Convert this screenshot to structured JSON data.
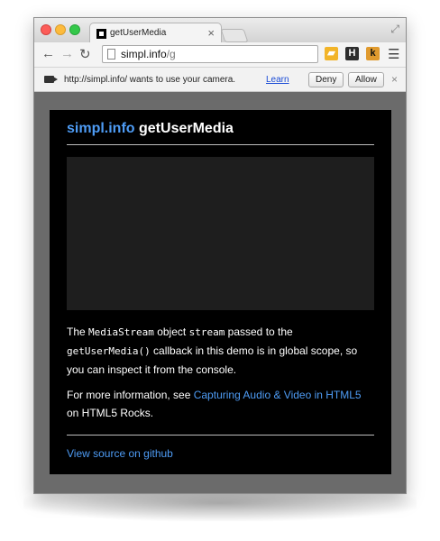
{
  "browser": {
    "tab": {
      "title": "getUserMedia"
    },
    "address": {
      "host": "simpl.info",
      "path": "/g"
    },
    "toolbar": {
      "back_icon": "arrow-left-icon",
      "forward_icon": "arrow-right-icon",
      "reload_icon": "reload-icon",
      "extensions": [
        {
          "name": "folder-extension-icon",
          "glyph": ""
        },
        {
          "name": "h-extension-icon",
          "glyph": "H"
        },
        {
          "name": "k-extension-icon",
          "glyph": "k"
        }
      ]
    },
    "infobar": {
      "message": "http://simpl.info/ wants to use your camera.",
      "learn_link": "Learn",
      "deny_label": "Deny",
      "allow_label": "Allow"
    }
  },
  "page": {
    "title_brand": "simpl.info",
    "title_rest": " getUserMedia",
    "para1": {
      "text1": "The ",
      "code1": "MediaStream",
      "text2": " object ",
      "code2": "stream",
      "text3": " passed to the ",
      "code3": "getUserMedia()",
      "text4": " callback in this demo is in global scope, so you can inspect it from the console."
    },
    "para2": {
      "text1": "For more information, see ",
      "link": "Capturing Audio & Video in HTML5",
      "text2": " on HTML5 Rocks."
    },
    "source_link": "View source on github"
  },
  "colors": {
    "accent": "#4e9cf5",
    "page_bg": "#000000",
    "window_bg": "#6b6b6b",
    "video_bg": "#1e1e1e"
  }
}
